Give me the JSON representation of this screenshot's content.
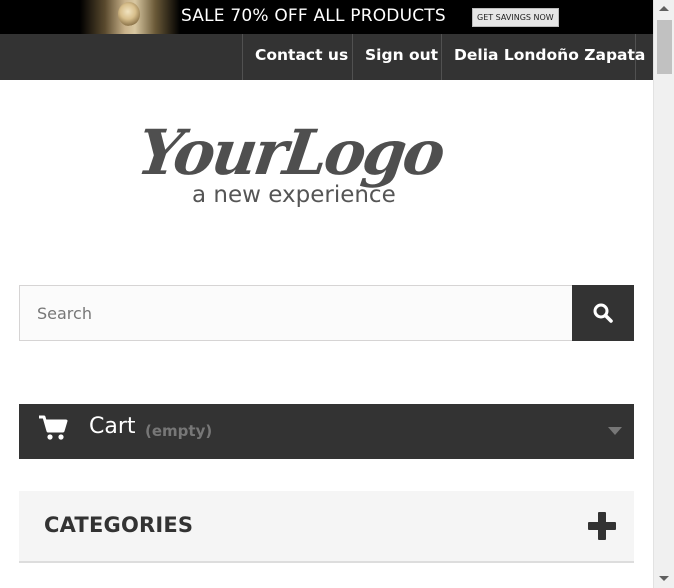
{
  "banner": {
    "text": "SALE 70% OFF ALL PRODUCTS",
    "cta": "GET SAVINGS NOW"
  },
  "nav": {
    "contact": "Contact us",
    "signout": "Sign out",
    "user": "Delia Londoño Zapata"
  },
  "logo": {
    "main": "YourLogo",
    "tagline": "a new experience"
  },
  "search": {
    "placeholder": "Search",
    "value": ""
  },
  "cart": {
    "label": "Cart",
    "status": "(empty)"
  },
  "categories": {
    "title": "CATEGORIES"
  },
  "icons": {
    "search": "search-icon",
    "cart": "cart-icon",
    "caret": "chevron-down-icon",
    "expand": "plus-icon"
  },
  "colors": {
    "dark": "#333333",
    "banner_bg": "#000000",
    "muted": "#777777",
    "panel": "#f5f5f5"
  }
}
